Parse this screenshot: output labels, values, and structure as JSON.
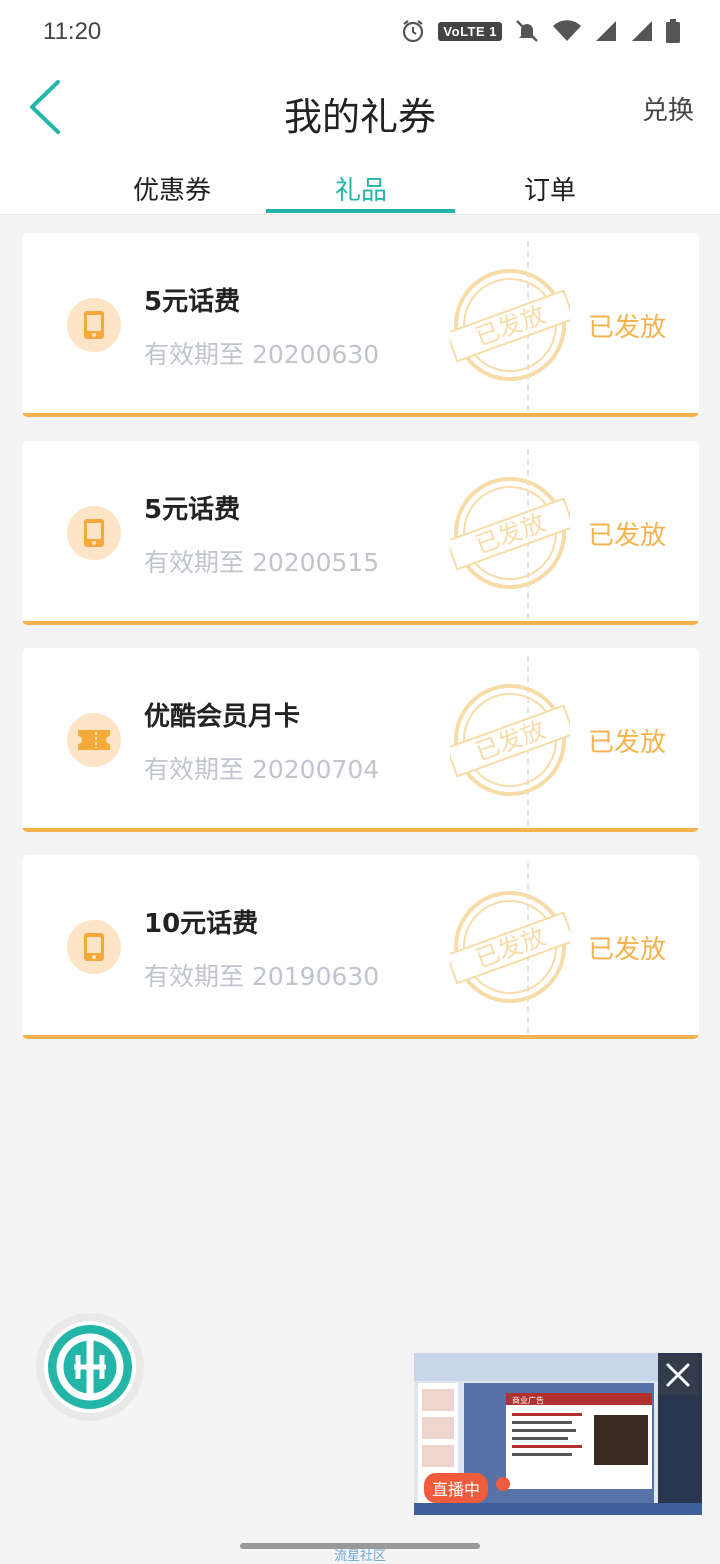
{
  "status_bar": {
    "time": "11:20",
    "volte_label": "VoLTE 1",
    "icons": [
      "alarm-icon",
      "volte-badge",
      "mute-bell-icon",
      "wifi-icon",
      "signal-icon",
      "signal-icon",
      "battery-icon"
    ]
  },
  "header": {
    "title": "我的礼券",
    "redeem_label": "兑换",
    "back_icon": "chevron-left-icon"
  },
  "tabs": [
    {
      "label": "优惠券",
      "active": false
    },
    {
      "label": "礼品",
      "active": true
    },
    {
      "label": "订单",
      "active": false
    }
  ],
  "accent_color": "#22b5a8",
  "status_color": "#f5b24e",
  "cards": [
    {
      "title": "5元话费",
      "expiry": "有效期至 20200630",
      "status": "已发放",
      "stamp": "已发放",
      "icon": "phone-icon"
    },
    {
      "title": "5元话费",
      "expiry": "有效期至 20200515",
      "status": "已发放",
      "stamp": "已发放",
      "icon": "phone-icon"
    },
    {
      "title": "优酷会员月卡",
      "expiry": "有效期至 20200704",
      "status": "已发放",
      "stamp": "已发放",
      "icon": "ticket-icon"
    },
    {
      "title": "10元话费",
      "expiry": "有效期至 20190630",
      "status": "已发放",
      "stamp": "已发放",
      "icon": "phone-icon"
    }
  ],
  "floating": {
    "logo_icon": "bank-logo-icon",
    "live_badge": "直播中",
    "live_close_icon": "close-icon",
    "slide_heading": "商业广告"
  },
  "watermark": "流星社区"
}
